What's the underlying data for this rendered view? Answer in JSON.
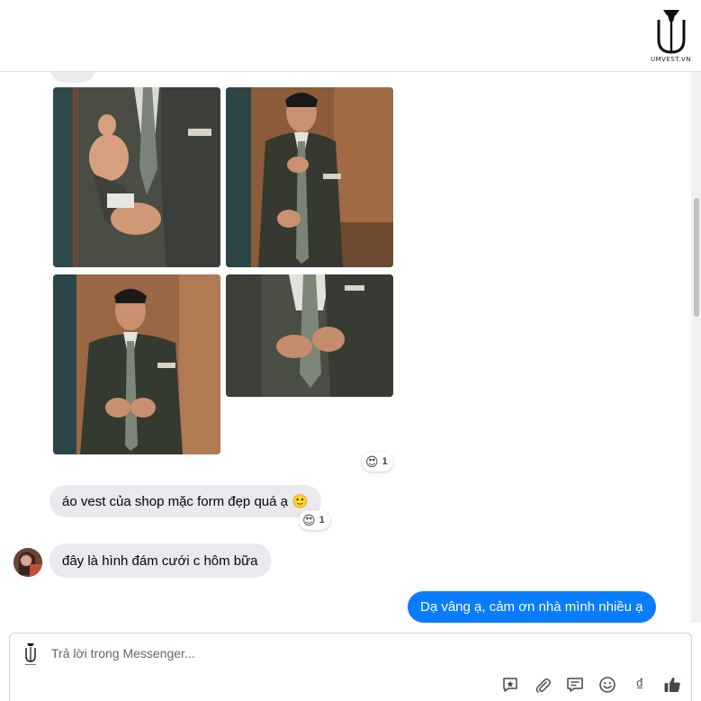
{
  "header": {
    "logo_icon": "umvest-logo-icon",
    "logo_caption": "UMVEST.VN"
  },
  "thread": {
    "photos": [
      {
        "icon": "man-adjusting-cufflink-photo"
      },
      {
        "icon": "man-adjusting-sleeve-photo"
      },
      {
        "icon": "man-buttoning-jacket-photo"
      },
      {
        "icon": "man-closeup-jacket-photo"
      }
    ],
    "photo_reaction": {
      "emoji": "😍",
      "count": "1"
    },
    "message_1": {
      "text": "áo vest của shop mặc form đẹp quá ạ 🙂",
      "reaction_emoji": "😍",
      "reaction_count": "1"
    },
    "message_2": {
      "text": "đây là hình đám cưới c hôm bữa",
      "avatar_icon": "customer-avatar"
    },
    "message_3": {
      "text": "Dạ vâng ạ, cảm ơn nhà mình nhiều ạ"
    }
  },
  "composer": {
    "placeholder": "Trả lời trong Messenger...",
    "tools": [
      {
        "icon": "sticker-star-icon"
      },
      {
        "icon": "paperclip-icon"
      },
      {
        "icon": "saved-reply-icon"
      },
      {
        "icon": "emoji-icon"
      },
      {
        "icon": "currency-dong-icon",
        "label": "₫"
      },
      {
        "icon": "thumbs-up-icon"
      }
    ]
  },
  "colors": {
    "outgoing_bubble": "#0a7cff",
    "incoming_bubble": "#e9eaed"
  }
}
